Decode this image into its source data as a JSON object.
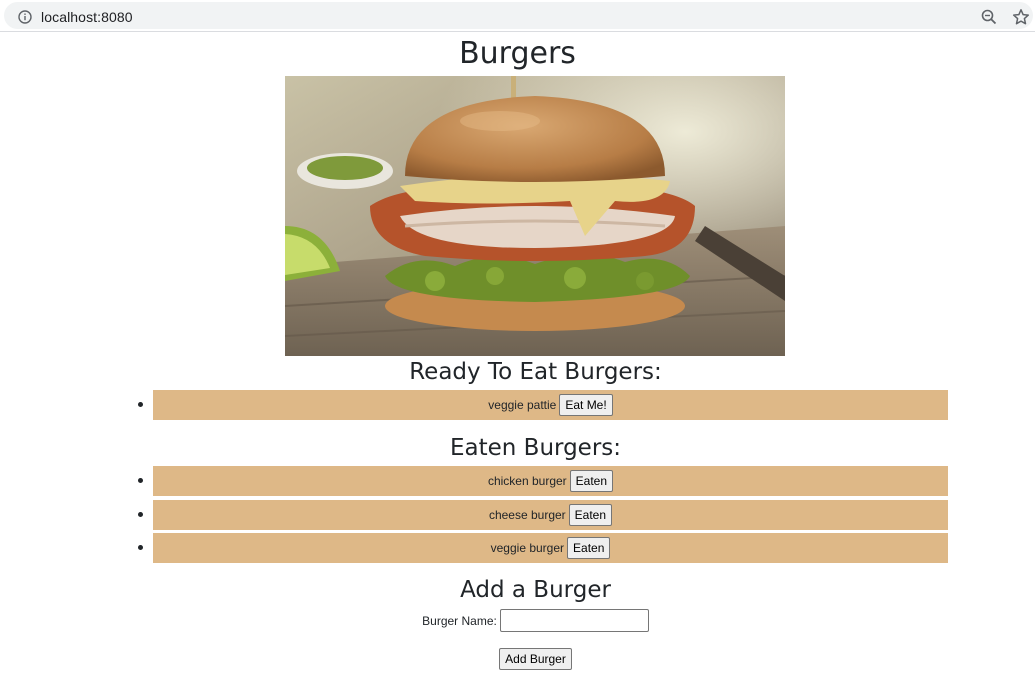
{
  "browser": {
    "url": "localhost:8080"
  },
  "page": {
    "title": "Burgers",
    "hero_image": "burger-photo",
    "ready_heading": "Ready To Eat Burgers:",
    "ready": [
      {
        "name": "veggie pattie",
        "button": "Eat Me!"
      }
    ],
    "eaten_heading": "Eaten Burgers:",
    "eaten": [
      {
        "name": "chicken burger",
        "button": "Eaten"
      },
      {
        "name": "cheese burger",
        "button": "Eaten"
      },
      {
        "name": "veggie burger",
        "button": "Eaten"
      }
    ],
    "form": {
      "heading": "Add a Burger",
      "label": "Burger Name:",
      "value": "",
      "submit": "Add Burger"
    }
  },
  "colors": {
    "row_background": "#deb887",
    "text": "#212529"
  }
}
